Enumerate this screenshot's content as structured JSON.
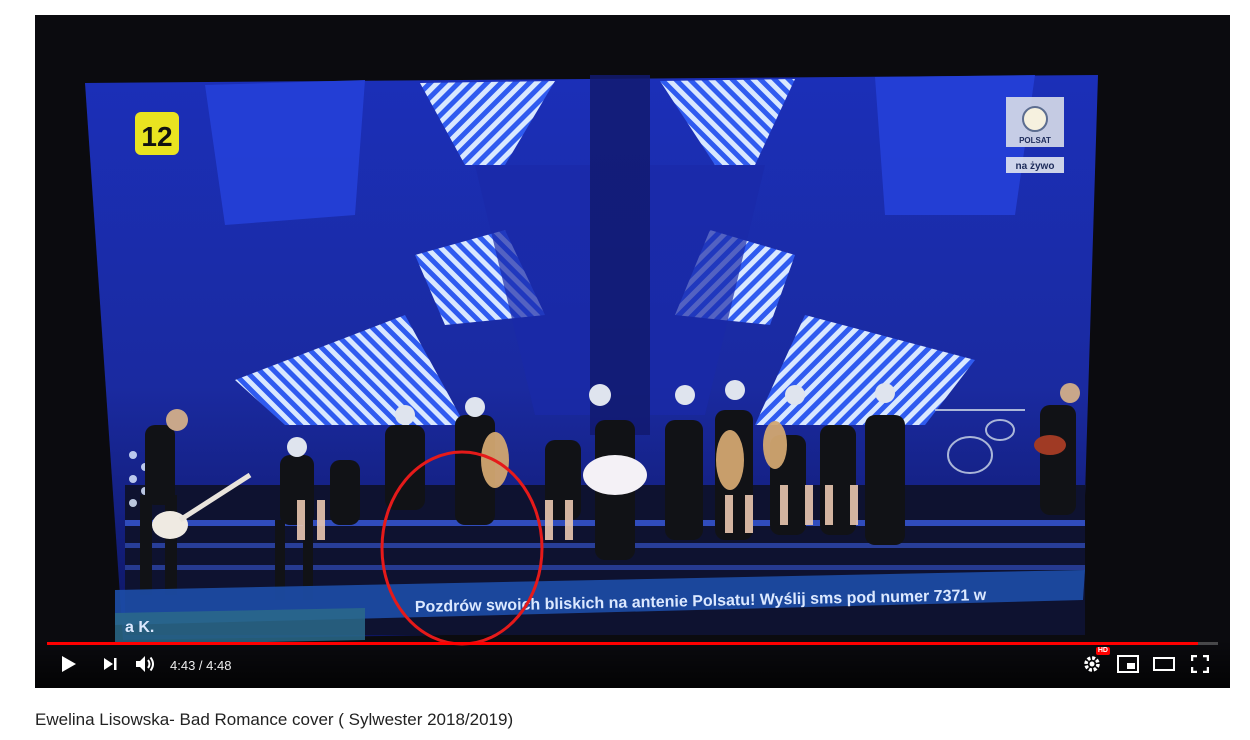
{
  "video": {
    "overlay": {
      "channel_rating": "12",
      "broadcaster_logo_text": "POLSAT",
      "live_label": "na żywo",
      "ticker_text": "Pozdrów swoich bliskich na antenie Polsatu! Wyślij sms pod numer 7371 w",
      "ticker_left_fragment": "a K."
    },
    "progress_fraction": 0.9826,
    "annotation_color": "#e51a1a"
  },
  "controls": {
    "time_display": "4:43 / 4:48",
    "hd_badge": "HD",
    "icons": [
      "play-icon",
      "next-icon",
      "volume-icon",
      "settings-icon",
      "miniplayer-icon",
      "theater-icon",
      "fullscreen-icon"
    ],
    "accent_color": "#ff0000"
  },
  "caption": {
    "title": "Ewelina Lisowska- Bad Romance cover ( Sylwester 2018/2019)"
  }
}
